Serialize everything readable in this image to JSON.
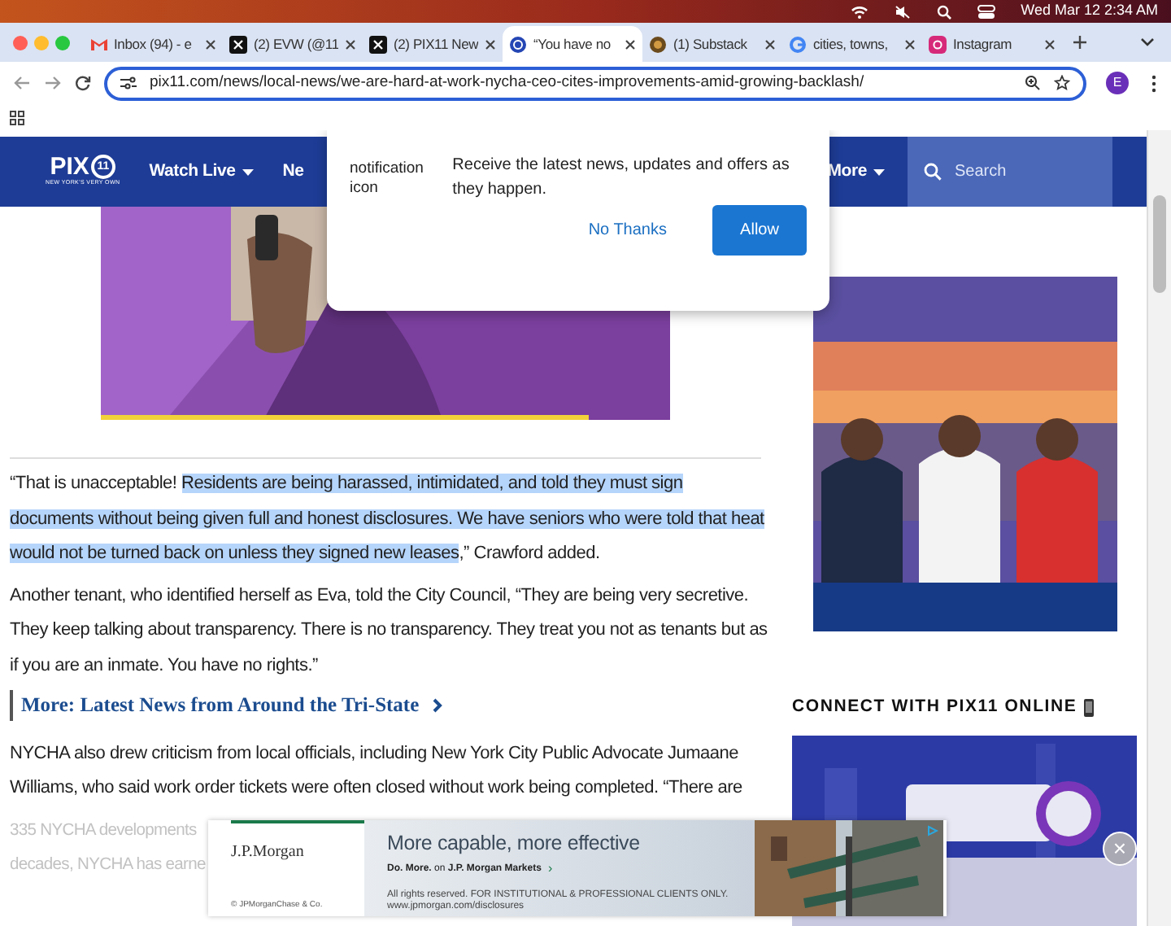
{
  "menu_bar": {
    "date_time": "Wed Mar 12  2:34 AM"
  },
  "tabs": [
    {
      "title": "Inbox (94) - e",
      "kind": "mail",
      "selected": false
    },
    {
      "title": "(2) EVW (@11",
      "kind": "x",
      "selected": false
    },
    {
      "title": "(2) PIX11 New",
      "kind": "x",
      "selected": false
    },
    {
      "title": "“You have no",
      "kind": "site",
      "selected": true
    },
    {
      "title": "(1) Substack",
      "kind": "substack",
      "selected": false
    },
    {
      "title": "cities, towns,",
      "kind": "google",
      "selected": false
    },
    {
      "title": "Instagram",
      "kind": "instagram",
      "selected": false
    }
  ],
  "address_bar": {
    "url": "pix11.com/news/local-news/we-are-hard-at-work-nycha-ceo-cites-improvements-amid-growing-backlash/"
  },
  "profile": "E",
  "site_nav": {
    "logo": "PIX",
    "logo_number": "11",
    "tagline": "NEW YORK'S VERY OWN",
    "items": [
      {
        "label": "Watch Live",
        "dropdown": true
      },
      {
        "label": "Ne",
        "dropdown": false
      },
      {
        "label": "More",
        "dropdown": true
      }
    ],
    "search": {
      "placeholder": "Search"
    }
  },
  "notification": {
    "icon_alt": "notification icon",
    "message": "Receive the latest news, updates and offers as they happen.",
    "buttons": [
      {
        "label": "No Thanks",
        "kind": "link"
      },
      {
        "label": "Allow",
        "kind": "primary"
      }
    ]
  },
  "article": {
    "blocks": [
      {
        "kind": "paragraph",
        "segments": [
          {
            "text": "“That is unacceptable! ",
            "selected": false
          },
          {
            "text": "Residents are being harassed, intimidated, and told they must sign documents without being given full and honest disclosures. We have seniors who were told that heat would not be turned back on unless they signed new leases",
            "selected": true
          },
          {
            "text": ",” Crawford added.",
            "selected": false
          }
        ]
      },
      {
        "kind": "paragraph",
        "segments": [
          {
            "text": "Another tenant, who identified herself as Eva, told the City Council, “They are being very secretive. They keep talking about transparency. There is no transparency. They treat you not as tenants but as if you are an inmate. You have no rights.”",
            "selected": false
          }
        ]
      },
      {
        "kind": "link",
        "text": "More: Latest News from Around the Tri-State"
      },
      {
        "kind": "paragraph",
        "segments": [
          {
            "text": "NYCHA also drew criticism from local officials, including New York City Public Advocate Jumaane Williams, who said work order tickets were often closed without work being completed. “There are",
            "selected": false
          }
        ]
      },
      {
        "kind": "faded",
        "text": "335 NYCHA developments"
      },
      {
        "kind": "faded",
        "text": "decades, NYCHA has earne"
      }
    ]
  },
  "sidebar": {
    "heading": "CONNECT WITH PIX11 ONLINE"
  },
  "ad": {
    "brand": "J.P.Morgan",
    "copyright": "© JPMorganChase & Co.",
    "headline": "More capable, more effective",
    "subline": "**Do. More.** on **J.P. Morgan Markets**",
    "chevron": "›",
    "fine_print": "All rights reserved. FOR INSTITUTIONAL & PROFESSIONAL CLIENTS ONLY. www.jpmorgan.com/disclosures",
    "close": "×"
  }
}
